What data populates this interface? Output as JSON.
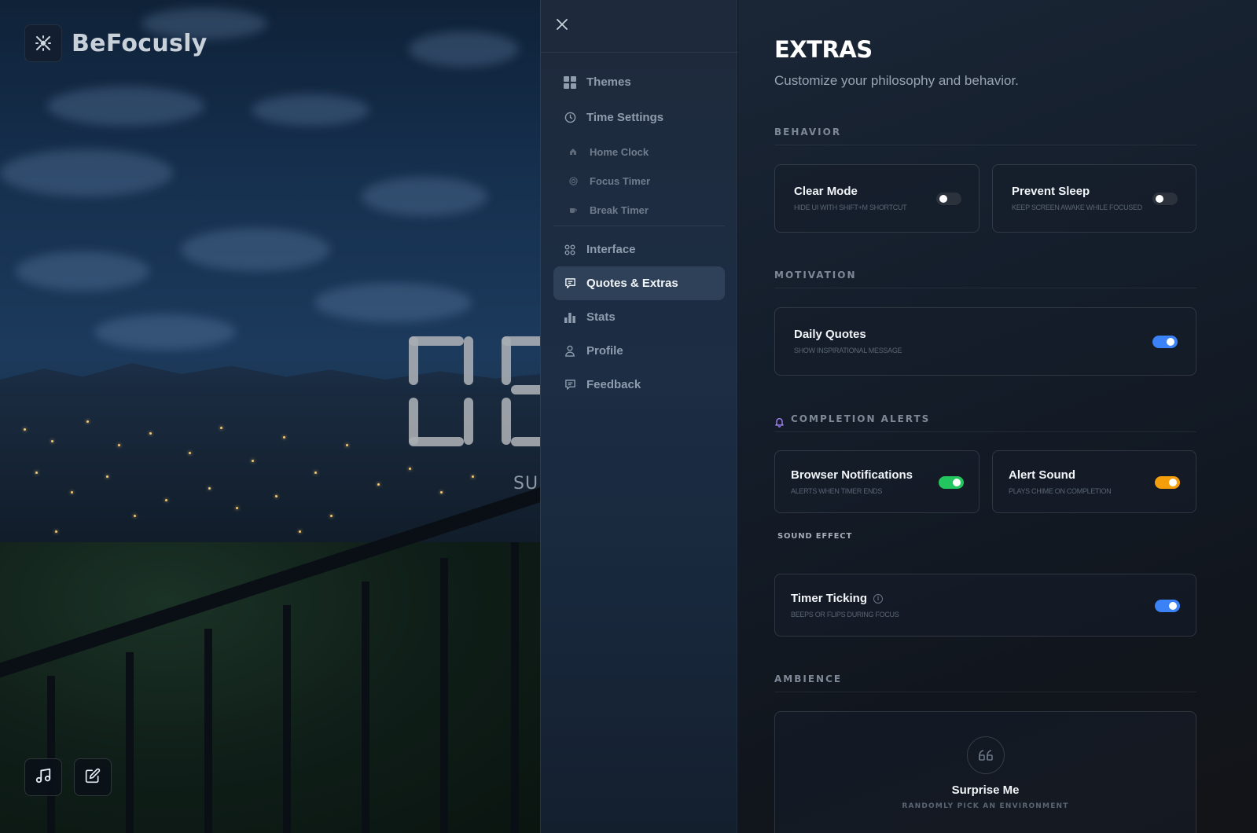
{
  "app": {
    "brand_name": "BeFocusly"
  },
  "clock": {
    "partial_text": "SU"
  },
  "sidebar": {
    "items": [
      {
        "label": "Themes"
      },
      {
        "label": "Time Settings"
      },
      {
        "label": "Home Clock"
      },
      {
        "label": "Focus Timer"
      },
      {
        "label": "Break Timer"
      },
      {
        "label": "Interface"
      },
      {
        "label": "Quotes & Extras"
      },
      {
        "label": "Stats"
      },
      {
        "label": "Profile"
      },
      {
        "label": "Feedback"
      }
    ],
    "active": "Quotes & Extras"
  },
  "panel": {
    "title": "EXTRAS",
    "subtitle": "Customize your philosophy and behavior.",
    "behavior": {
      "header": "BEHAVIOR",
      "clear_mode": {
        "title": "Clear Mode",
        "sub": "HIDE UI WITH SHIFT+M SHORTCUT",
        "on": false
      },
      "prevent_sleep": {
        "title": "Prevent Sleep",
        "sub": "KEEP SCREEN AWAKE WHILE FOCUSED",
        "on": false
      }
    },
    "motivation": {
      "header": "MOTIVATION",
      "daily_quotes": {
        "title": "Daily Quotes",
        "sub": "SHOW INSPIRATIONAL MESSAGE",
        "on": true
      }
    },
    "alerts": {
      "header": "COMPLETION ALERTS",
      "browser_notifications": {
        "title": "Browser Notifications",
        "sub": "ALERTS WHEN TIMER ENDS",
        "on": true
      },
      "alert_sound": {
        "title": "Alert Sound",
        "sub": "PLAYS CHIME ON COMPLETION",
        "on": true
      },
      "sound_effect_label": "SOUND EFFECT",
      "timer_ticking": {
        "title": "Timer Ticking",
        "sub": "BEEPS OR FLIPS DURING FOCUS",
        "on": true
      }
    },
    "ambience": {
      "header": "AMBIENCE",
      "surprise": {
        "title": "Surprise Me",
        "sub": "RANDOMLY PICK AN ENVIRONMENT"
      }
    }
  },
  "colors": {
    "toggle_blue": "#3b82f6",
    "toggle_green": "#22c55e",
    "toggle_orange": "#f59e0b",
    "toggle_off": "#2b323c",
    "active_nav": "#2f4158",
    "alert_bell": "#a78bfa"
  },
  "icons": {
    "logo": "focus-burst-icon",
    "music": "music-note-icon",
    "edit": "edit-icon",
    "close": "close-icon"
  }
}
